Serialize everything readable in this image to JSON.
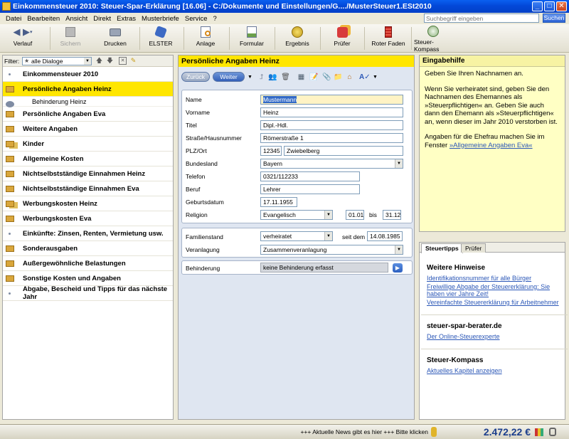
{
  "window": {
    "title": "Einkommensteuer 2010: Steuer-Spar-Erklärung [16.06] - C:/Dokumente und Einstellungen/G..../MusterSteuer1.ESt2010"
  },
  "menubar": [
    "Datei",
    "Bearbeiten",
    "Ansicht",
    "Direkt",
    "Extras",
    "Musterbriefe",
    "Service",
    "?"
  ],
  "search": {
    "placeholder": "Suchbegriff eingeben",
    "button": "Suchen"
  },
  "toolbar": [
    {
      "name": "verlauf",
      "label": "Verlauf",
      "icon": "arrow-icon",
      "disabled": false
    },
    {
      "name": "sichern",
      "label": "Sichern",
      "icon": "floppy-icon",
      "disabled": true
    },
    {
      "name": "drucken",
      "label": "Drucken",
      "icon": "printer-icon",
      "disabled": false
    },
    {
      "name": "elster",
      "label": "ELSTER",
      "icon": "elster-icon",
      "disabled": false
    },
    {
      "name": "anlage",
      "label": "Anlage",
      "icon": "magnifier-icon",
      "disabled": false
    },
    {
      "name": "formular",
      "label": "Formular",
      "icon": "form-icon",
      "disabled": false
    },
    {
      "name": "ergebnis",
      "label": "Ergebnis",
      "icon": "coin-icon",
      "disabled": false
    },
    {
      "name": "pruefer",
      "label": "Prüfer",
      "icon": "checker-icon",
      "disabled": false
    },
    {
      "name": "roter-faden",
      "label": "Roter Faden",
      "icon": "thread-icon",
      "disabled": false
    },
    {
      "name": "steuer-kompass",
      "label": "Steuer-Kompass",
      "icon": "compass-icon",
      "disabled": false
    }
  ],
  "filter": {
    "label": "Filter:",
    "value": "alle Dialoge"
  },
  "nav": [
    {
      "label": "Einkommensteuer 2010",
      "icon": "dot"
    },
    {
      "label": "Persönliche Angaben Heinz",
      "icon": "folder",
      "active": true
    },
    {
      "label": "Behinderung Heinz",
      "icon": "subdot",
      "sub": true
    },
    {
      "label": "Persönliche Angaben Eva",
      "icon": "folder"
    },
    {
      "label": "Weitere Angaben",
      "icon": "folder"
    },
    {
      "label": "Kinder",
      "icon": "folder2"
    },
    {
      "label": "Allgemeine Kosten",
      "icon": "folder"
    },
    {
      "label": "Nichtselbstständige Einnahmen Heinz",
      "icon": "folder"
    },
    {
      "label": "Nichtselbstständige Einnahmen Eva",
      "icon": "folder"
    },
    {
      "label": "Werbungskosten Heinz",
      "icon": "folder2"
    },
    {
      "label": "Werbungskosten Eva",
      "icon": "folder"
    },
    {
      "label": "Einkünfte: Zinsen, Renten, Vermietung usw.",
      "icon": "dot"
    },
    {
      "label": "Sonderausgaben",
      "icon": "folder"
    },
    {
      "label": "Außergewöhnliche Belastungen",
      "icon": "folder"
    },
    {
      "label": "Sonstige Kosten und Angaben",
      "icon": "folder"
    },
    {
      "label": "Abgabe, Bescheid und Tipps für das nächste Jahr",
      "icon": "dot"
    }
  ],
  "center": {
    "title": "Persönliche Angaben Heinz",
    "back": "Zurück",
    "next": "Weiter",
    "form": {
      "name_label": "Name",
      "name": "Mustermann",
      "vorname_label": "Vorname",
      "vorname": "Heinz",
      "titel_label": "Titel",
      "titel": "Dipl.-Hdl.",
      "strasse_label": "Straße/Hausnummer",
      "strasse": "Römerstraße 1",
      "plz_label": "PLZ/Ort",
      "plz": "12345",
      "ort": "Zwiebelberg",
      "bundesland_label": "Bundesland",
      "bundesland": "Bayern",
      "telefon_label": "Telefon",
      "telefon": "0321/112233",
      "beruf_label": "Beruf",
      "beruf": "Lehrer",
      "geburtsdatum_label": "Geburtsdatum",
      "geburtsdatum": "17.11.1955",
      "religion_label": "Religion",
      "religion": "Evangelisch",
      "religion_from": "01.01",
      "bis_label": "bis",
      "religion_to": "31.12",
      "familienstand_label": "Familienstand",
      "familienstand": "verheiratet",
      "seit_label": "seit dem",
      "seit": "14.08.1985",
      "veranlagung_label": "Veranlagung",
      "veranlagung": "Zusammenveranlagung",
      "behinderung_label": "Behinderung",
      "behinderung": "keine Behinderung erfasst"
    }
  },
  "help": {
    "title": "Eingabehilfe",
    "p1": "Geben Sie Ihren Nachnamen an.",
    "p2": "Wenn Sie verheiratet sind, geben Sie den Nachnamen des Ehemannes als »Steuerpflichtigen« an. Geben Sie auch dann den Ehemann als »Steuerpflichtigen« an, wenn dieser im Jahr 2010 verstorben ist.",
    "p3": "Angaben für die Ehefrau machen Sie im Fenster ",
    "p3_link": "»Allgemeine Angaben Eva«"
  },
  "tips": {
    "tab1": "Steuertipps",
    "tab2": "Prüfer",
    "h1": "Weitere Hinweise",
    "links1": [
      "Identifikationsnummer für alle Bürger",
      "Freiwillige Abgabe der Steuererklärung: Sie haben vier Jahre Zeit!",
      "Vereinfachte Steuererklärung für Arbeitnehmer"
    ],
    "h2": "steuer-spar-berater.de",
    "link2": "Der Online-Steuerexperte",
    "h3": "Steuer-Kompass",
    "link3": "Aktuelles Kapitel anzeigen"
  },
  "status": {
    "news": "+++ Aktuelle News gibt es hier +++ Bitte klicken",
    "balance": "2.472,22 €"
  }
}
